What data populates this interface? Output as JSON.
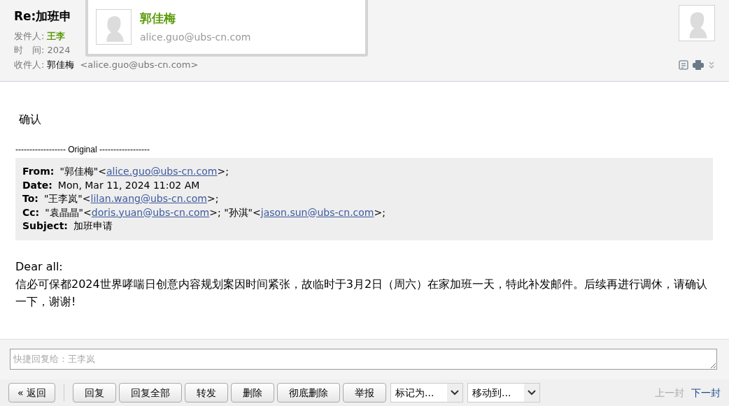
{
  "header": {
    "subject": "Re:加班申",
    "sender_label": "发件人:",
    "sender": "王李",
    "time_label": "时　间:",
    "time": "2024",
    "recipient_label": "收件人:",
    "recipient_name": "郭佳梅",
    "recipient_email": "<alice.guo@ubs-cn.com>"
  },
  "contact_popup": {
    "name": "郭佳梅",
    "email": "alice.guo@ubs-cn.com"
  },
  "body": {
    "greeting": "确认",
    "divider": "------------------ Original ------------------",
    "quote": [
      {
        "label": "From:",
        "parts": [
          {
            "text": "\"郭佳梅\"<"
          },
          {
            "link": "alice.guo@ubs-cn.com"
          },
          {
            "text": ">;"
          }
        ]
      },
      {
        "label": "Date:",
        "parts": [
          {
            "text": "Mon, Mar 11, 2024 11:02 AM"
          }
        ]
      },
      {
        "label": "To:",
        "parts": [
          {
            "text": "\"王李岚\"<"
          },
          {
            "link": "lilan.wang@ubs-cn.com"
          },
          {
            "text": ">;"
          }
        ]
      },
      {
        "label": "Cc:",
        "parts": [
          {
            "text": "\"袁晶晶\"<"
          },
          {
            "link": "doris.yuan@ubs-cn.com"
          },
          {
            "text": ">; \"孙淇\"<"
          },
          {
            "link": "jason.sun@ubs-cn.com"
          },
          {
            "text": ">;"
          }
        ]
      },
      {
        "label": "Subject:",
        "parts": [
          {
            "text": "加班申请"
          }
        ]
      }
    ],
    "message": [
      "Dear all:",
      "信必可保都2024世界哮喘日创意内容规划案因时间紧张，故临时于3月2日（周六）在家加班一天，特此补发邮件。后续再进行调休，请确认一下，谢谢!"
    ]
  },
  "quick_reply": {
    "placeholder": "快捷回复给：王李岚"
  },
  "toolbar": {
    "back": "« 返回",
    "buttons": [
      "回复",
      "回复全部",
      "转发",
      "删除",
      "彻底删除",
      "举报"
    ],
    "selects": [
      "标记为...",
      "移动到..."
    ],
    "nav": [
      {
        "label": "上一封",
        "disabled": true
      },
      {
        "label": "下一封",
        "disabled": false
      }
    ]
  }
}
